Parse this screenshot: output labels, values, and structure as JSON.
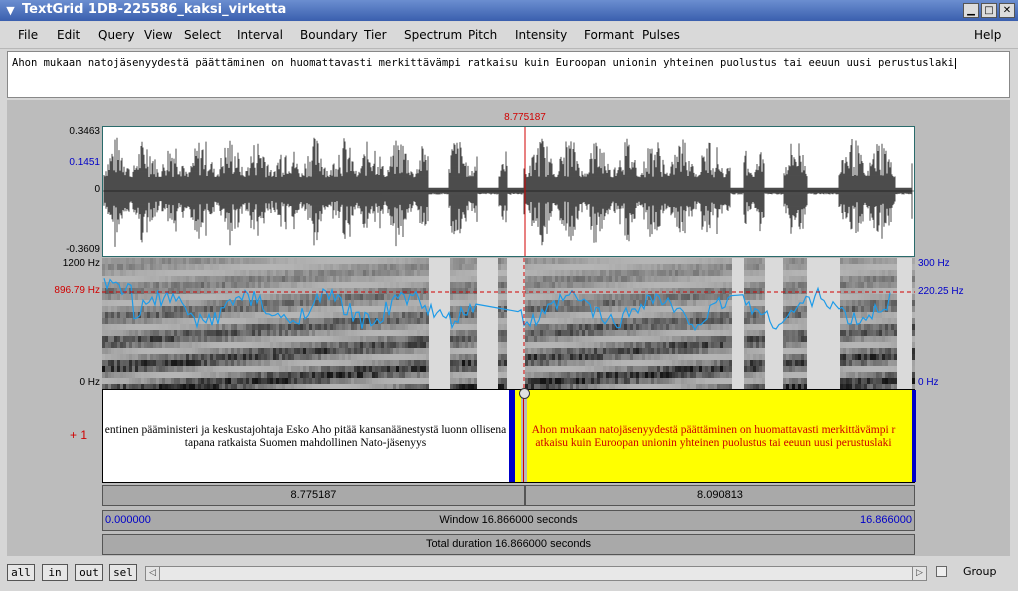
{
  "window": {
    "title": "TextGrid 1DB-225586_kaksi_virketta",
    "sysmenu_icon": "chevron-down-icon",
    "minimize_glyph": "▁",
    "maximize_glyph": "□",
    "close_glyph": "✕"
  },
  "menu": {
    "items": [
      "File",
      "Edit",
      "Query",
      "View",
      "Select",
      "Interval",
      "Boundary",
      "Tier",
      "Spectrum",
      "Pitch",
      "Intensity",
      "Formant",
      "Pulses"
    ],
    "help": "Help"
  },
  "text_field": {
    "value": "Ahon mukaan natojäsenyydestä päättäminen on huomattavasti merkittävämpi ratkaisu kuin Euroopan unionin yhteinen puolustus tai eeuun uusi perustuslaki"
  },
  "waveform": {
    "cursor_time": "8.775187",
    "y_max": "0.3463",
    "y_cursor": "0.1451",
    "y_zero": "0",
    "y_min": "-0.3609"
  },
  "spectrogram": {
    "left_max": "1200 Hz",
    "left_cursor": "896.79 Hz",
    "left_min": "0 Hz",
    "right_max": "300 Hz",
    "right_cursor": "220.25 Hz",
    "right_min": "0 Hz"
  },
  "tier": {
    "marker": "+ 1",
    "interval_1_text": "entinen pääministeri ja keskustajohtaja Esko Aho pitää kansanäänestystä luonn ollisena tapana ratkaista Suomen mahdollinen Nato-jäsenyys",
    "interval_2_text": "Ahon mukaan natojäsenyydestä päättäminen on huomattavasti merkittävämpi r atkaisu kuin Euroopan unionin yhteinen puolustus tai eeuun uusi perustuslaki",
    "highlight_color": "#ffff00",
    "selected_text_color": "#cc0000"
  },
  "timebars": {
    "left_duration": "8.775187",
    "right_duration": "8.090813",
    "window_start": "0.000000",
    "window_label": "Window 16.866000 seconds",
    "window_end": "16.866000",
    "total_label": "Total duration 16.866000 seconds"
  },
  "bottom": {
    "all": "all",
    "in": "in",
    "out": "out",
    "sel": "sel",
    "group": "Group"
  }
}
